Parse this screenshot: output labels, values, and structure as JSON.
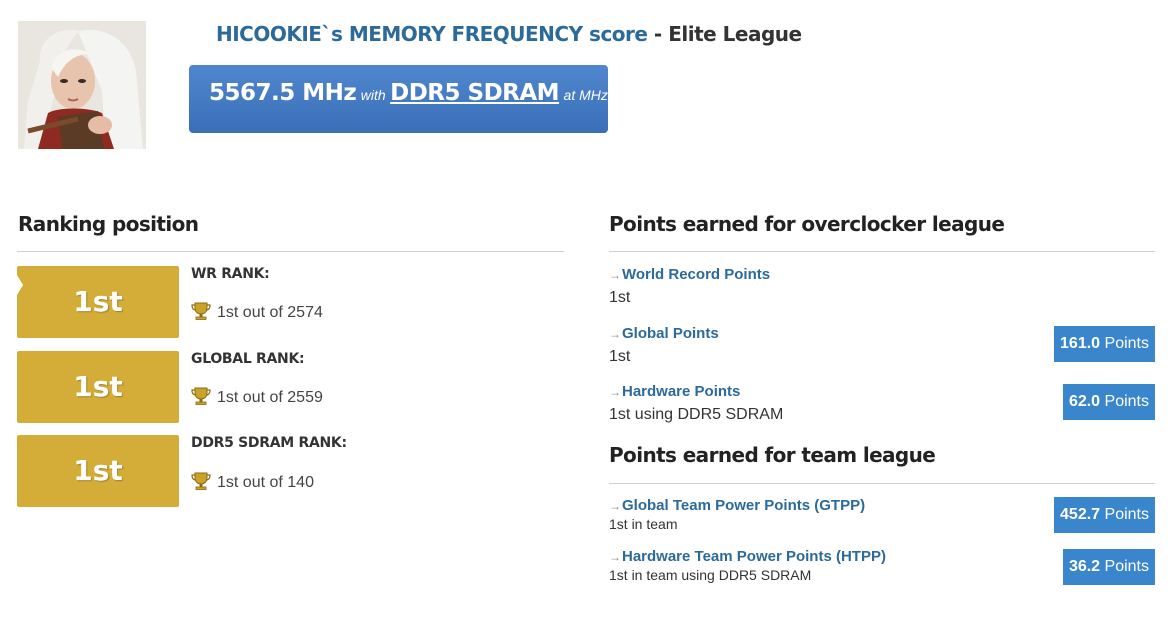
{
  "header": {
    "user_name": "HICOOKIE`s MEMORY FREQUENCY score",
    "league_suffix": " - Elite League"
  },
  "score": {
    "value": "5567.5 MHz",
    "with_text": "with",
    "hardware": "DDR5 SDRAM",
    "at_text": "at MHz"
  },
  "ranking": {
    "heading": "Ranking position",
    "items": [
      {
        "badge": "1st",
        "label": "WR RANK:",
        "out_of": "1st out of 2574"
      },
      {
        "badge": "1st",
        "label": "GLOBAL RANK:",
        "out_of": "1st out of 2559"
      },
      {
        "badge": "1st",
        "label": "DDR5 SDRAM RANK:",
        "out_of": "1st out of 140"
      }
    ]
  },
  "overclocker": {
    "heading": "Points earned for overclocker league",
    "items": [
      {
        "label": "World Record Points",
        "sub": "1st",
        "points_value": "",
        "points_unit": ""
      },
      {
        "label": "Global Points",
        "sub": "1st",
        "points_value": "161.0",
        "points_unit": "Points"
      },
      {
        "label": "Hardware Points",
        "sub": "1st using DDR5 SDRAM",
        "points_value": "62.0",
        "points_unit": "Points"
      }
    ]
  },
  "team": {
    "heading": "Points earned for team league",
    "items": [
      {
        "label": "Global Team Power Points (GTPP)",
        "sub": "1st in team",
        "points_value": "452.7",
        "points_unit": "Points"
      },
      {
        "label": "Hardware Team Power Points (HTPP)",
        "sub": "1st in team using DDR5 SDRAM",
        "points_value": "36.2",
        "points_unit": "Points"
      }
    ]
  },
  "colors": {
    "brand_blue": "#2b6a99",
    "score_box": "#4079c4",
    "rank_gold": "#d3ad37",
    "points_badge": "#3a86cc"
  },
  "icons": {
    "arrow": "→",
    "trophy": "trophy-icon"
  }
}
